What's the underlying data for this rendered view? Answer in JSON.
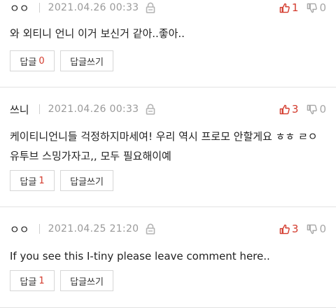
{
  "comments": [
    {
      "author": "ㅇㅇ",
      "date": "2021.04.26 00:33",
      "text": "와 외티니 언니 이거 보신거 같아..좋아..",
      "likes": "1",
      "dislikes": "0",
      "reply_label": "답글",
      "reply_count": "0",
      "write_label": "답글쓰기"
    },
    {
      "author": "쓰니",
      "date": "2021.04.26 00:33",
      "text": "케이티니언니들 걱정하지마세여! 우리 역시 프로모 안할게요 ㅎㅎ ㄹㅇ 유투브 스밍가자고,, 모두 필요해이예",
      "likes": "3",
      "dislikes": "0",
      "reply_label": "답글",
      "reply_count": "1",
      "write_label": "답글쓰기"
    },
    {
      "author": "ㅇㅇ",
      "date": "2021.04.25 21:20",
      "text": "If you see this I-tiny please leave comment here..",
      "likes": "3",
      "dislikes": "0",
      "reply_label": "답글",
      "reply_count": "1",
      "write_label": "답글쓰기"
    }
  ],
  "colors": {
    "like": "#d33a2c",
    "dislike": "#a7a7a7",
    "divider": "#e2e2e2"
  },
  "icons": {
    "like": "thumbs-up-icon",
    "dislike": "thumbs-down-icon",
    "lock": "lock-icon"
  }
}
